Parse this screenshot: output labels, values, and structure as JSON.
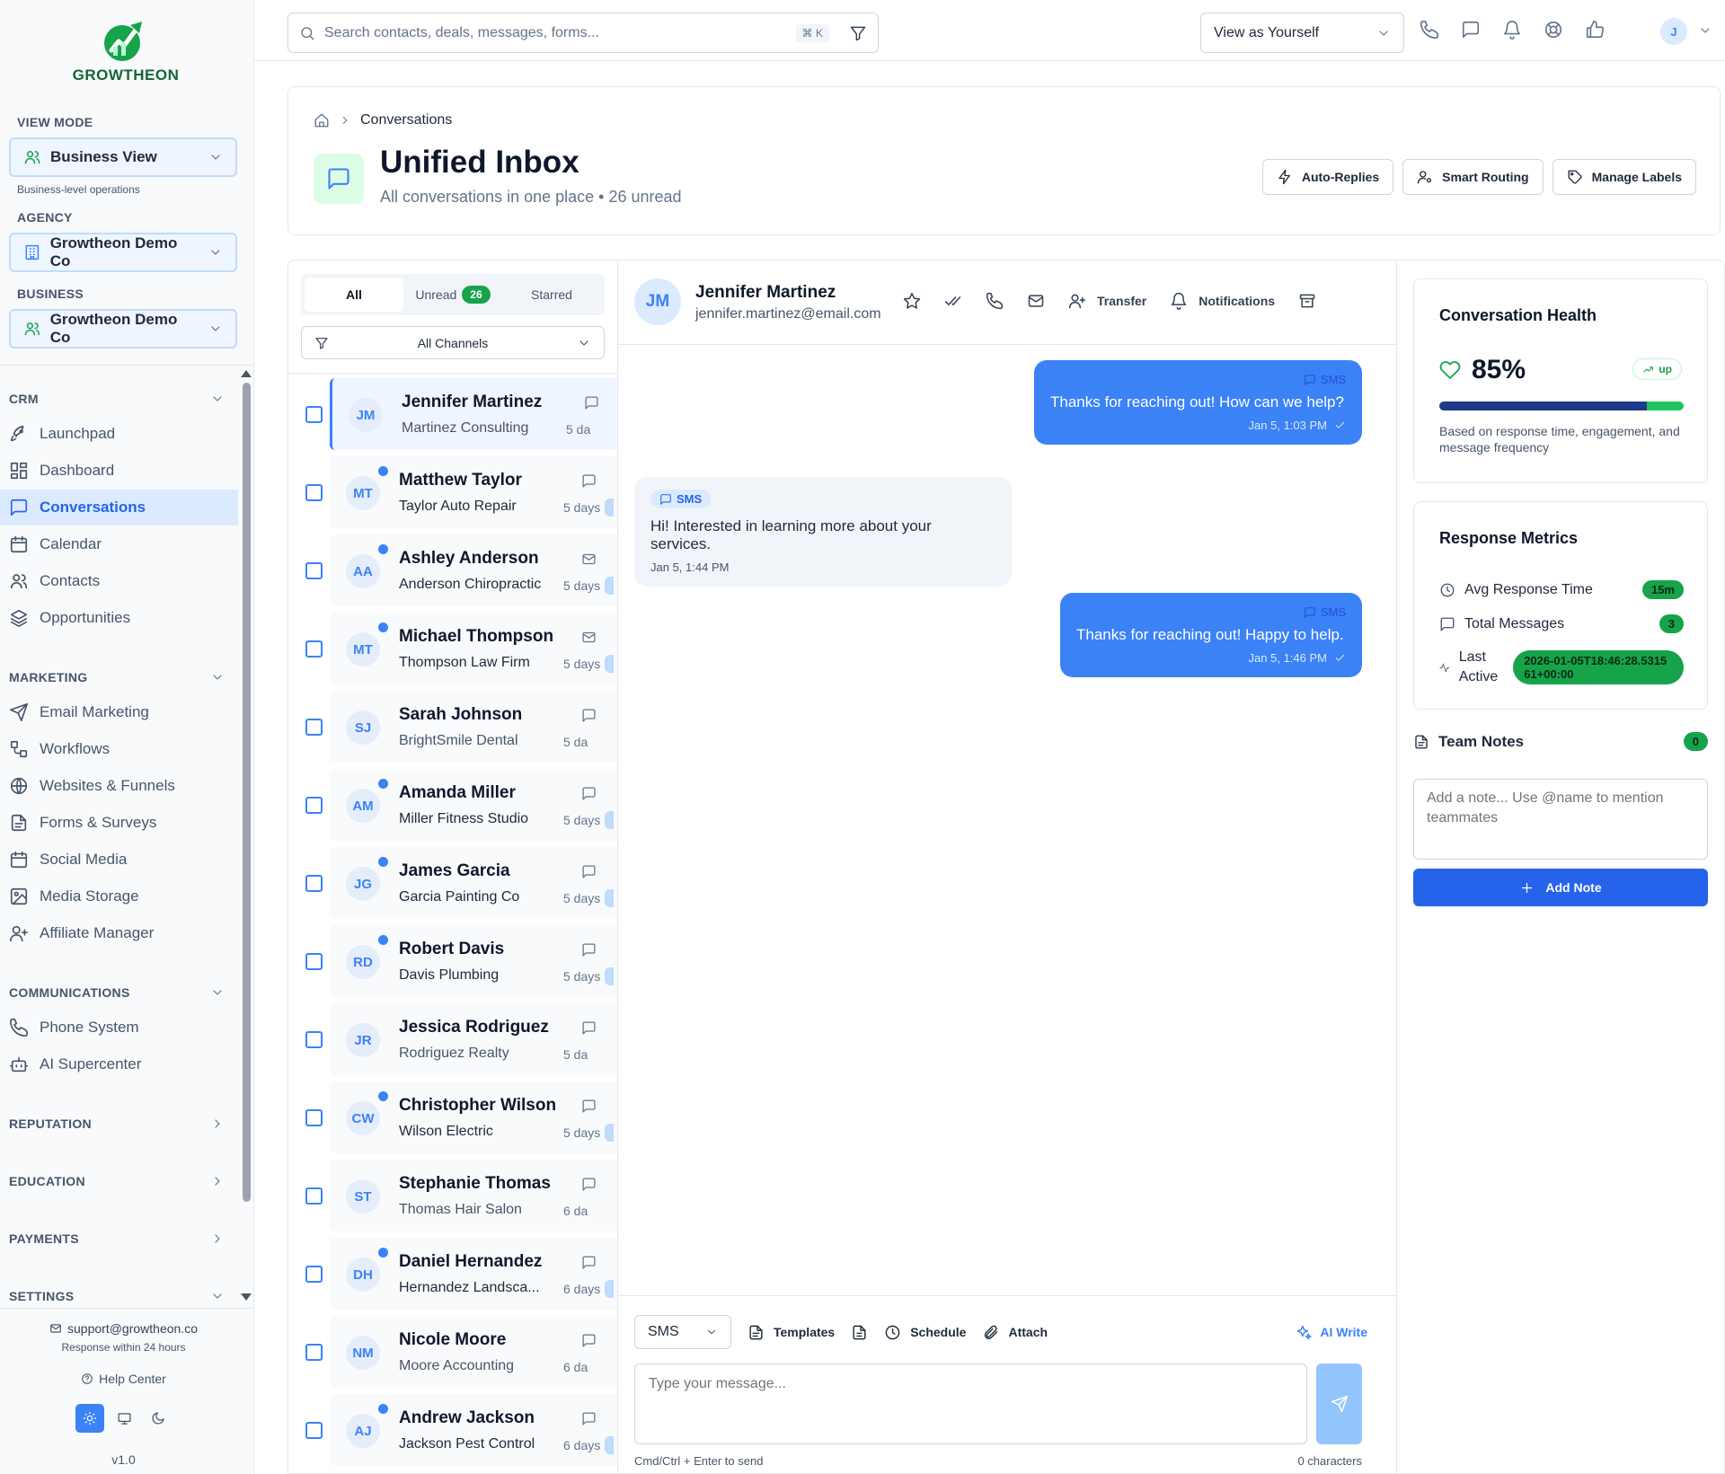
{
  "brand": {
    "name": "GROWTHEON"
  },
  "sidebar": {
    "view_mode_label": "VIEW MODE",
    "view_mode_value": "Business View",
    "view_mode_note": "Business-level operations",
    "agency_label": "AGENCY",
    "agency_value": "Growtheon Demo Co",
    "business_label": "BUSINESS",
    "business_value": "Growtheon Demo Co",
    "groups": {
      "crm": "CRM",
      "marketing": "MARKETING",
      "communications": "COMMUNICATIONS",
      "reputation": "REPUTATION",
      "education": "EDUCATION",
      "payments": "PAYMENTS",
      "settings": "SETTINGS"
    },
    "crm_items": [
      "Launchpad",
      "Dashboard",
      "Conversations",
      "Calendar",
      "Contacts",
      "Opportunities"
    ],
    "marketing_items": [
      "Email Marketing",
      "Workflows",
      "Websites & Funnels",
      "Forms & Surveys",
      "Social Media",
      "Media Storage",
      "Affiliate Manager"
    ],
    "comm_items": [
      "Phone System",
      "AI Supercenter"
    ],
    "active_item": "Conversations",
    "support_email": "support@growtheon.co",
    "support_note": "Response within 24 hours",
    "help_center": "Help Center",
    "version": "v1.0"
  },
  "topbar": {
    "search_placeholder": "Search contacts, deals, messages, forms...",
    "shortcut": "⌘ K",
    "view_as": "View as Yourself",
    "avatar_initial": "J"
  },
  "header": {
    "breadcrumb": "Conversations",
    "title": "Unified Inbox",
    "subtitle": "All conversations in one place • 26 unread",
    "buttons": [
      "Auto-Replies",
      "Smart Routing",
      "Manage Labels"
    ]
  },
  "list": {
    "tabs": {
      "all": "All",
      "unread": "Unread",
      "unread_count": "26",
      "starred": "Starred"
    },
    "channel_filter": "All Channels",
    "conversations": [
      {
        "initials": "JM",
        "name": "Jennifer Martinez",
        "company": "Martinez Consulting",
        "time": "5 da",
        "unread": false,
        "selected": true,
        "channel": "sms"
      },
      {
        "initials": "MT",
        "name": "Matthew Taylor",
        "company": "Taylor Auto Repair",
        "time": "5 days",
        "unread": true,
        "selected": false,
        "channel": "sms"
      },
      {
        "initials": "AA",
        "name": "Ashley Anderson",
        "company": "Anderson Chiropractic",
        "time": "5 days",
        "unread": true,
        "selected": false,
        "channel": "email"
      },
      {
        "initials": "MT",
        "name": "Michael Thompson",
        "company": "Thompson Law Firm",
        "time": "5 days",
        "unread": true,
        "selected": false,
        "channel": "email"
      },
      {
        "initials": "SJ",
        "name": "Sarah Johnson",
        "company": "BrightSmile Dental",
        "time": "5 da",
        "unread": false,
        "selected": false,
        "channel": "sms"
      },
      {
        "initials": "AM",
        "name": "Amanda Miller",
        "company": "Miller Fitness Studio",
        "time": "5 days",
        "unread": true,
        "selected": false,
        "channel": "sms"
      },
      {
        "initials": "JG",
        "name": "James Garcia",
        "company": "Garcia Painting Co",
        "time": "5 days",
        "unread": true,
        "selected": false,
        "channel": "sms"
      },
      {
        "initials": "RD",
        "name": "Robert Davis",
        "company": "Davis Plumbing",
        "time": "5 days",
        "unread": true,
        "selected": false,
        "channel": "sms"
      },
      {
        "initials": "JR",
        "name": "Jessica Rodriguez",
        "company": "Rodriguez Realty",
        "time": "5 da",
        "unread": false,
        "selected": false,
        "channel": "sms"
      },
      {
        "initials": "CW",
        "name": "Christopher Wilson",
        "company": "Wilson Electric",
        "time": "5 days",
        "unread": true,
        "selected": false,
        "channel": "sms"
      },
      {
        "initials": "ST",
        "name": "Stephanie Thomas",
        "company": "Thomas Hair Salon",
        "time": "6 da",
        "unread": false,
        "selected": false,
        "channel": "sms"
      },
      {
        "initials": "DH",
        "name": "Daniel Hernandez",
        "company": "Hernandez Landsca...",
        "time": "6 days",
        "unread": true,
        "selected": false,
        "channel": "sms"
      },
      {
        "initials": "NM",
        "name": "Nicole Moore",
        "company": "Moore Accounting",
        "time": "6 da",
        "unread": false,
        "selected": false,
        "channel": "sms"
      },
      {
        "initials": "AJ",
        "name": "Andrew Jackson",
        "company": "Jackson Pest Control",
        "time": "6 days",
        "unread": true,
        "selected": false,
        "channel": "sms"
      }
    ]
  },
  "thread": {
    "contact_initials": "JM",
    "contact_name": "Jennifer Martinez",
    "contact_email": "jennifer.martinez@email.com",
    "actions": {
      "transfer": "Transfer",
      "notifications": "Notifications"
    },
    "messages": [
      {
        "dir": "out",
        "channel": "SMS",
        "text": "Thanks for reaching out! How can we help?",
        "time": "Jan 5, 1:03 PM"
      },
      {
        "dir": "in",
        "channel": "SMS",
        "text": "Hi! Interested in learning more about your services.",
        "time": "Jan 5, 1:44 PM"
      },
      {
        "dir": "out",
        "channel": "SMS",
        "text": "Thanks for reaching out! Happy to help.",
        "time": "Jan 5, 1:46 PM"
      }
    ],
    "composer": {
      "channel": "SMS",
      "templates": "Templates",
      "schedule": "Schedule",
      "attach": "Attach",
      "ai_write": "AI Write",
      "placeholder": "Type your message...",
      "hint": "Cmd/Ctrl + Enter to send",
      "count": "0 characters"
    }
  },
  "right": {
    "health_title": "Conversation Health",
    "health_value": "85%",
    "health_pct": 85,
    "health_trend": "up",
    "health_note": "Based on response time, engagement, and message frequency",
    "metrics_title": "Response Metrics",
    "metrics": [
      {
        "label": "Avg Response Time",
        "value": "15m"
      },
      {
        "label": "Total Messages",
        "value": "3"
      },
      {
        "label": "Last Active",
        "value": "2026-01-05T18:46:28.531561+00:00"
      }
    ],
    "notes_title": "Team Notes",
    "notes_count": "0",
    "notes_placeholder": "Add a note... Use @name to mention teammates",
    "add_note": "Add Note"
  }
}
